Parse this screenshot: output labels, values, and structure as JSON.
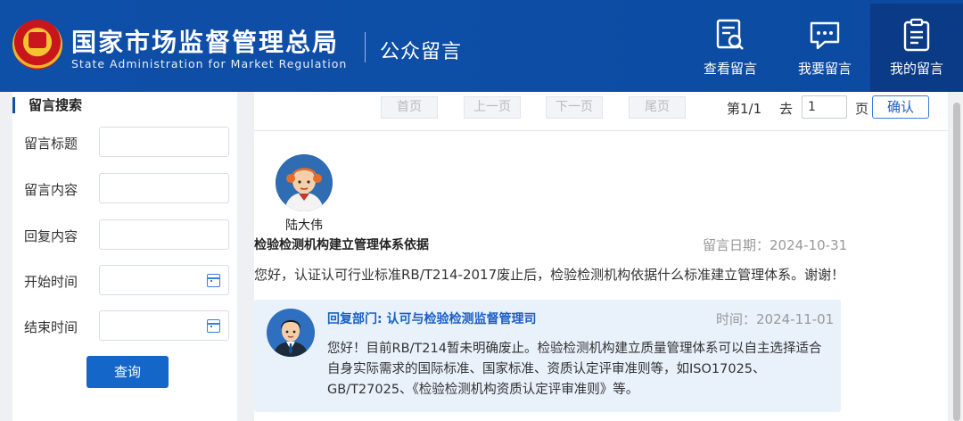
{
  "header": {
    "org_cn": "国家市场监督管理总局",
    "org_en": "State Administration for Market Regulation",
    "section_title": "公众留言",
    "nav": [
      {
        "label": "查看留言",
        "icon": "search-document-icon"
      },
      {
        "label": "我要留言",
        "icon": "chat-bubble-icon"
      },
      {
        "label": "我的留言",
        "icon": "clipboard-list-icon",
        "active": true
      }
    ]
  },
  "sidebar": {
    "title": "留言搜索",
    "fields": [
      {
        "label": "留言标题",
        "value": ""
      },
      {
        "label": "留言内容",
        "value": ""
      },
      {
        "label": "回复内容",
        "value": ""
      },
      {
        "label": "开始时间",
        "value": ""
      },
      {
        "label": "结束时间",
        "value": ""
      }
    ],
    "query_button": "查询"
  },
  "pager": {
    "first": "首页",
    "prev": "上一页",
    "next": "下一页",
    "last": "尾页",
    "page_info": "第1/1",
    "goto_label": "去",
    "goto_value": "1",
    "page_unit": "页",
    "confirm": "确认"
  },
  "message": {
    "author": "陆大伟",
    "title": "检验检测机构建立管理体系依据",
    "date": "留言日期：2024-10-31",
    "body": "您好，认证认可行业标准RB/T214-2017废止后，检验检测机构依据什么标准建立管理体系。谢谢！"
  },
  "reply": {
    "dept": "回复部门: 认可与检验检测监督管理司",
    "time": "时间：2024-11-01",
    "body": "您好！目前RB/T214暂未明确废止。检验检测机构建立质量管理体系可以自主选择适合自身实际需求的国际标准、国家标准、资质认定评审准则等，如ISO17025、GB/T27025、《检验检测机构资质认定评审准则》等。"
  },
  "colors": {
    "header_bg": "#0e4fa8",
    "active_nav_bg": "#0b3a86",
    "accent": "#1566c9",
    "reply_bg": "#e9f1fb"
  }
}
